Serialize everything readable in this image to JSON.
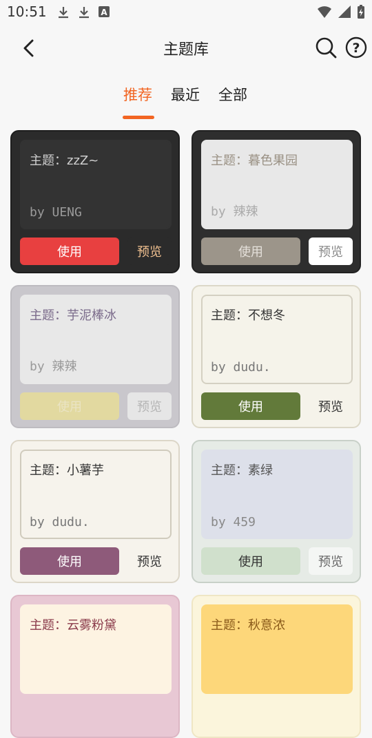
{
  "status_bar": {
    "time": "10:51",
    "left_icons": [
      "download-icon",
      "download-icon",
      "app-icon"
    ],
    "right_icons": [
      "wifi-icon",
      "signal-icon",
      "battery-charging-icon"
    ],
    "app_icon_letter": "A"
  },
  "header": {
    "title": "主题库",
    "back_icon": "back-arrow-icon",
    "search_icon": "search-icon",
    "help_icon": "help-icon",
    "help_glyph": "?"
  },
  "tabs": [
    {
      "label": "推荐",
      "active": true
    },
    {
      "label": "最近",
      "active": false
    },
    {
      "label": "全部",
      "active": false
    }
  ],
  "accent_color": "#f26522",
  "themes": [
    {
      "name": "主题：zzZ~",
      "author": "by UENG",
      "use_label": "使用",
      "preview_label": "预览",
      "colors": {
        "card_bg": "#2b2b2b",
        "card_border": "#1e1e1e",
        "inner_bg": "#333333",
        "inner_border": "#333333",
        "name": "#cfcfcf",
        "author": "#9a9a9a",
        "use_bg": "#e84040",
        "use_text": "#ffffff",
        "preview_bg": "#2b2b2b",
        "preview_text": "#f0c090"
      }
    },
    {
      "name": "主题：暮色果园",
      "author": "by 辣辣",
      "use_label": "使用",
      "preview_label": "预览",
      "colors": {
        "card_bg": "#2e2e2e",
        "card_border": "#222222",
        "inner_bg": "#e8e8e8",
        "inner_border": "#e8e8e8",
        "name": "#9a9184",
        "author": "#aaaaaa",
        "use_bg": "#9c958a",
        "use_text": "#e4e0da",
        "preview_bg": "#ffffff",
        "preview_text": "#888888"
      }
    },
    {
      "name": "主题：芋泥棒冰",
      "author": "by 辣辣",
      "use_label": "使用",
      "preview_label": "预览",
      "colors": {
        "card_bg": "#c9c7cc",
        "card_border": "#bdbbc0",
        "inner_bg": "#e8e8e8",
        "inner_border": "#e8e8e8",
        "name": "#7a6a8a",
        "author": "#9a9a9a",
        "use_bg": "#e2d9a0",
        "use_text": "#eae4c4",
        "preview_bg": "#e6e6e6",
        "preview_text": "#b5b5b5"
      }
    },
    {
      "name": "主题：不想冬",
      "author": "by dudu.",
      "use_label": "使用",
      "preview_label": "预览",
      "colors": {
        "card_bg": "#f5f3ea",
        "card_border": "#dcd8c8",
        "inner_bg": "#f5f3ea",
        "inner_border": "#d4d0c2",
        "name": "#333333",
        "author": "#777777",
        "use_bg": "#627a3a",
        "use_text": "#ffffff",
        "preview_bg": "#f5f3ea",
        "preview_text": "#333333"
      }
    },
    {
      "name": "主题：小薯芋",
      "author": "by dudu.",
      "use_label": "使用",
      "preview_label": "预览",
      "colors": {
        "card_bg": "#f6f3ec",
        "card_border": "#dcd6c8",
        "inner_bg": "#f6f3ec",
        "inner_border": "#d0cbbd",
        "name": "#333333",
        "author": "#777777",
        "use_bg": "#8e5a7a",
        "use_text": "#ffffff",
        "preview_bg": "#f6f3ec",
        "preview_text": "#333333"
      }
    },
    {
      "name": "主题：素绿",
      "author": "by 459",
      "use_label": "使用",
      "preview_label": "预览",
      "colors": {
        "card_bg": "#e6ebe6",
        "card_border": "#c8d0c8",
        "inner_bg": "#dde0ea",
        "inner_border": "#dde0ea",
        "name": "#555555",
        "author": "#888888",
        "use_bg": "#d0e0cc",
        "use_text": "#333333",
        "preview_bg": "#f4f6f4",
        "preview_text": "#666666"
      }
    },
    {
      "name": "主题：云雾粉黛",
      "author": "",
      "use_label": "",
      "preview_label": "",
      "colors": {
        "card_bg": "#e8c8d4",
        "card_border": "#dcb6c4",
        "inner_bg": "#fdf3e2",
        "inner_border": "#fdf3e2",
        "name": "#8a3a4a",
        "author": "#888888",
        "use_bg": "#ffffff",
        "use_text": "#333333",
        "preview_bg": "#ffffff",
        "preview_text": "#333333"
      }
    },
    {
      "name": "主题：秋意浓",
      "author": "",
      "use_label": "",
      "preview_label": "",
      "colors": {
        "card_bg": "#fbf5dc",
        "card_border": "#efe6c4",
        "inner_bg": "#fdd77a",
        "inner_border": "#fdd77a",
        "name": "#8a5a1a",
        "author": "#888888",
        "use_bg": "#ffffff",
        "use_text": "#333333",
        "preview_bg": "#ffffff",
        "preview_text": "#333333"
      }
    }
  ]
}
